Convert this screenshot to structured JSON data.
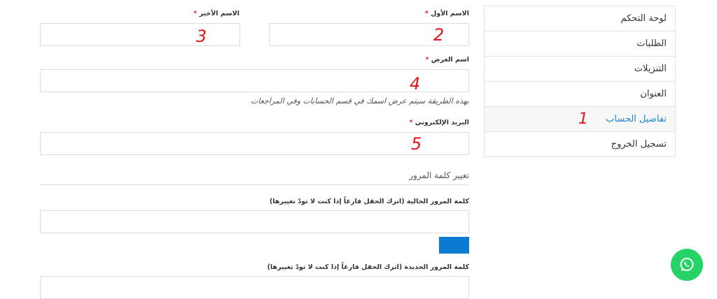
{
  "sidebar": {
    "items": [
      {
        "label": "لوحة التحكم"
      },
      {
        "label": "الطلبات"
      },
      {
        "label": "التنزيلات"
      },
      {
        "label": "العنوان"
      },
      {
        "label": "تفاصيل الحساب",
        "active": true
      },
      {
        "label": "تسجيل الخروج"
      }
    ]
  },
  "form": {
    "first_name": {
      "label": "الاسم الأول",
      "value": ""
    },
    "last_name": {
      "label": "الاسم الأخير",
      "value": ""
    },
    "display_name": {
      "label": "اسم العرض",
      "value": "",
      "hint": "بهذه الطريقة سيتم عرض اسمك في قسم الحسابات وفي المراجعات"
    },
    "email": {
      "label": "البريد الإلكتروني",
      "value": ""
    },
    "required_mark": "*",
    "password_section": {
      "title": "تغيير كلمة المرور",
      "current_label": "كلمة المرور الحالية (اترك الحقل فارغاً إذا كنت لا تودّ تغييرها)",
      "new_label": "كلمة المرور الجديدة (اترك الحقل فارغاً إذا كنت لا تودّ تغييرها)"
    }
  },
  "annotations": {
    "a1": "1",
    "a2": "2",
    "a3": "3",
    "a4": "4",
    "a5": "5"
  },
  "colors": {
    "accent": "#1e88c8",
    "required": "#e02424",
    "button": "#0a7bd1",
    "whatsapp": "#25d366",
    "annotation": "#e3141c"
  },
  "icons": {
    "chat": "whatsapp-icon"
  }
}
